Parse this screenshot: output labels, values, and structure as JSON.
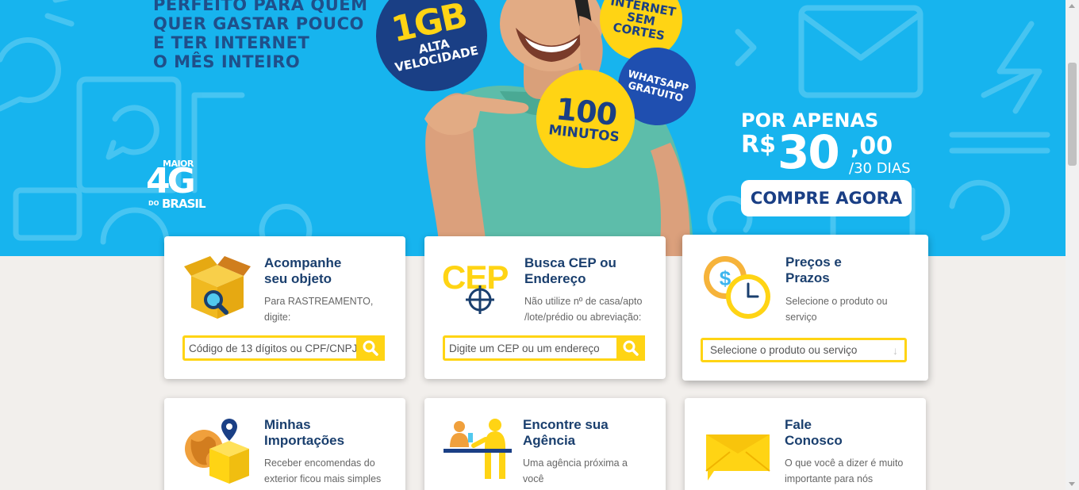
{
  "banner": {
    "headline": [
      "PERFEITO PARA QUEM",
      "QUER GASTAR POUCO",
      "E TER INTERNET",
      "O MÊS INTEIRO"
    ],
    "logo": {
      "maior": "MAIOR",
      "main": "4G",
      "do": "DO",
      "brasil": "BRASIL"
    },
    "bubbles": {
      "data": {
        "big": "1GB",
        "line1": "ALTA",
        "line2": "VELOCIDADE"
      },
      "internet": [
        "INTERNET",
        "SEM",
        "CORTES"
      ],
      "whatsapp": [
        "WHATSAPP",
        "GRATUITO"
      ],
      "minutes": {
        "big": "100",
        "small": "MINUTOS"
      }
    },
    "price": {
      "lead": "POR APENAS",
      "currency": "R$",
      "value": "30",
      "cents": ",00",
      "period": "/30 DIAS"
    },
    "cta_label": "COMPRE AGORA",
    "colors": {
      "background": "#17b4ee",
      "navy": "#1a3f85",
      "yellow": "#ffd414"
    }
  },
  "cards": {
    "track": {
      "title": [
        "Acompanhe",
        "seu objeto"
      ],
      "desc": [
        "Para RASTREAMENTO,",
        "digite:"
      ],
      "placeholder": "Código de 13 dígitos ou CPF/CNPJ",
      "icon": "package-search-icon"
    },
    "cep": {
      "title": [
        "Busca CEP ou",
        "Endereço"
      ],
      "icon_text": "CEP",
      "desc": [
        "Não utilize nº de casa/apto",
        "/lote/prédio ou abreviação:"
      ],
      "placeholder": "Digite um CEP ou um endereço",
      "icon": "cep-target-icon"
    },
    "prices": {
      "title": [
        "Preços e",
        "Prazos"
      ],
      "desc": [
        "Selecione o produto ou",
        "serviço"
      ],
      "select_value": "Selecione o produto ou serviço",
      "icon": "money-clock-icon"
    },
    "imports": {
      "title": [
        "Minhas",
        "Importações"
      ],
      "desc": [
        "Receber encomendas do",
        "exterior ficou mais simples"
      ],
      "icon": "globe-package-icon"
    },
    "agency": {
      "title": [
        "Encontre sua",
        "Agência"
      ],
      "desc": [
        "Uma agência próxima a",
        "você"
      ],
      "icon": "agency-counter-icon"
    },
    "contact": {
      "title": [
        "Fale",
        "Conosco"
      ],
      "desc": [
        "O que você a dizer é muito",
        "importante para nós"
      ],
      "icon": "speech-bubble-icon"
    }
  }
}
